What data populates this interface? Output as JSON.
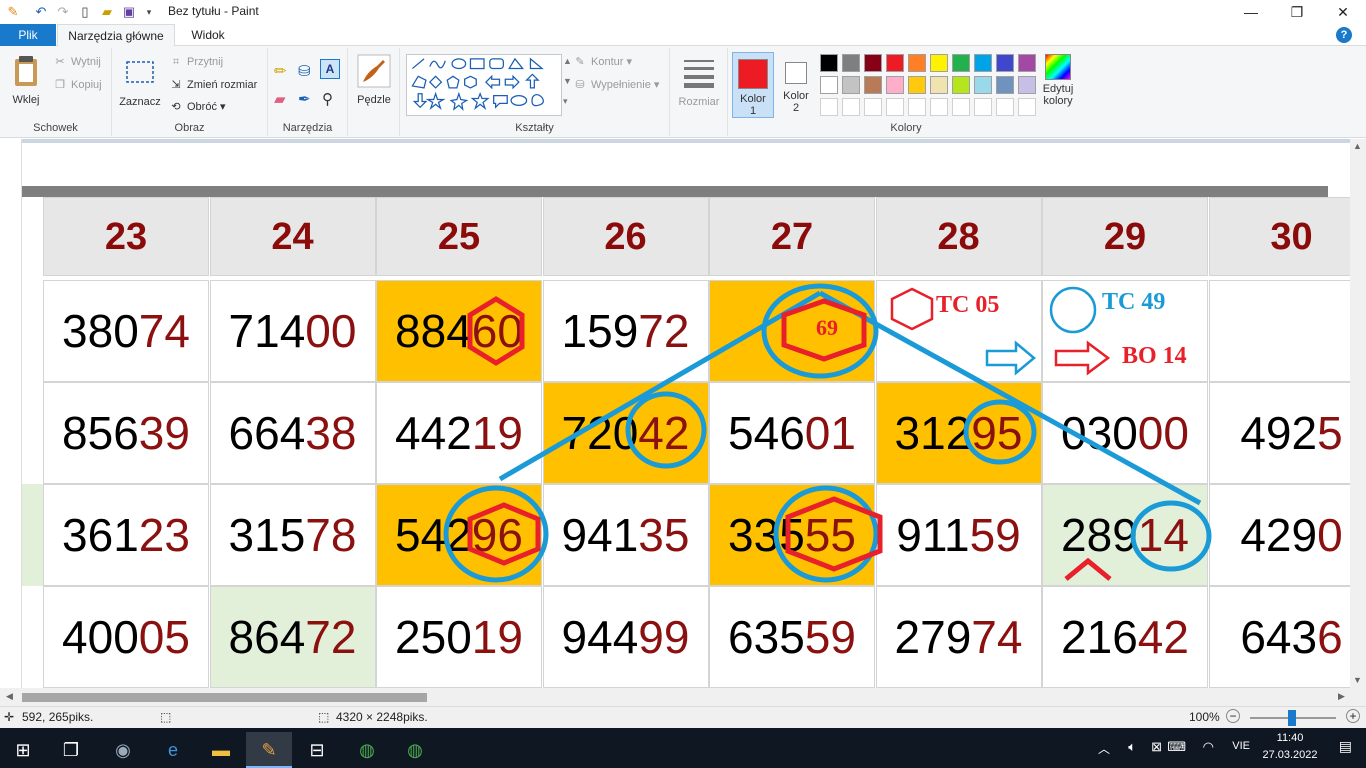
{
  "window": {
    "title": "Bez tytułu - Paint",
    "quick_access": [
      "paint-app-icon",
      "undo-icon",
      "redo-icon",
      "new-file-icon",
      "open-file-icon",
      "save-icon",
      "customize-dropdown-icon"
    ],
    "controls": [
      "minimize-icon",
      "restore-icon",
      "close-icon"
    ]
  },
  "tabs": [
    {
      "label": "Plik",
      "active": false
    },
    {
      "label": "Narzędzia główne",
      "active": true
    },
    {
      "label": "Widok",
      "active": false
    }
  ],
  "help_label": "?",
  "ribbon": {
    "clipboard": {
      "label": "Schowek",
      "paste": "Wklej",
      "cut": "Wytnij",
      "copy": "Kopiuj"
    },
    "image": {
      "label": "Obraz",
      "select": "Zaznacz",
      "crop": "Przytnij",
      "resize": "Zmień rozmiar",
      "rotate": "Obróć"
    },
    "tools": {
      "label": "Narzędzia"
    },
    "brushes": {
      "label": "Pędzle"
    },
    "shapes": {
      "label": "Kształty",
      "outline": "Kontur",
      "fill": "Wypełnienie"
    },
    "size": {
      "label": "Rozmiar"
    },
    "colors": {
      "label": "Kolory",
      "color1": "Kolor 1",
      "color2": "Kolor 2",
      "edit": "Edytuj kolory",
      "color1_value": "#ed1c24",
      "color2_value": "#ffffff",
      "palette_row1": [
        "#000000",
        "#7f7f7f",
        "#880015",
        "#ed1c24",
        "#ff7f27",
        "#fff200",
        "#22b14c",
        "#00a2e8",
        "#3f48cc",
        "#a349a4"
      ],
      "palette_row2": [
        "#ffffff",
        "#c3c3c3",
        "#b97a57",
        "#ffaec9",
        "#ffc90e",
        "#efe4b0",
        "#b5e61d",
        "#99d9ea",
        "#7092be",
        "#c8bfe7"
      ]
    }
  },
  "grid": {
    "headers": [
      "23",
      "24",
      "25",
      "26",
      "27",
      "28",
      "29",
      "30"
    ],
    "rows": [
      [
        {
          "head": "380",
          "tail": "74",
          "bg": "white"
        },
        {
          "head": "714",
          "tail": "00",
          "bg": "white"
        },
        {
          "head": "884",
          "tail": "60",
          "bg": "orange"
        },
        {
          "head": "159",
          "tail": "72",
          "bg": "white"
        },
        {
          "head": "",
          "tail": "",
          "bg": "orange"
        },
        {
          "head": "",
          "tail": "",
          "bg": "white"
        },
        {
          "head": "",
          "tail": "",
          "bg": "white"
        },
        {
          "head": "",
          "tail": "",
          "bg": "white"
        }
      ],
      [
        {
          "head": "856",
          "tail": "39",
          "bg": "white"
        },
        {
          "head": "664",
          "tail": "38",
          "bg": "white"
        },
        {
          "head": "442",
          "tail": "19",
          "bg": "white"
        },
        {
          "head": "720",
          "tail": "42",
          "bg": "orange"
        },
        {
          "head": "546",
          "tail": "01",
          "bg": "white"
        },
        {
          "head": "312",
          "tail": "95",
          "bg": "orange"
        },
        {
          "head": "030",
          "tail": "00",
          "bg": "white"
        },
        {
          "head": "492",
          "tail": "5",
          "bg": "white"
        }
      ],
      [
        {
          "head": "361",
          "tail": "23",
          "bg": "white"
        },
        {
          "head": "315",
          "tail": "78",
          "bg": "white"
        },
        {
          "head": "542",
          "tail": "96",
          "bg": "orange"
        },
        {
          "head": "941",
          "tail": "35",
          "bg": "white"
        },
        {
          "head": "335",
          "tail": "55",
          "bg": "orange"
        },
        {
          "head": "911",
          "tail": "59",
          "bg": "white"
        },
        {
          "head": "289",
          "tail": "14",
          "bg": "lgreen"
        },
        {
          "head": "429",
          "tail": "0",
          "bg": "white"
        }
      ],
      [
        {
          "head": "400",
          "tail": "05",
          "bg": "white"
        },
        {
          "head": "864",
          "tail": "72",
          "bg": "lgreen"
        },
        {
          "head": "250",
          "tail": "19",
          "bg": "white"
        },
        {
          "head": "944",
          "tail": "99",
          "bg": "white"
        },
        {
          "head": "635",
          "tail": "59",
          "bg": "white"
        },
        {
          "head": "279",
          "tail": "74",
          "bg": "white"
        },
        {
          "head": "216",
          "tail": "42",
          "bg": "white"
        },
        {
          "head": "643",
          "tail": "6",
          "bg": "white"
        }
      ]
    ]
  },
  "annotations": {
    "center_value": "69",
    "tc05": "TC 05",
    "tc49": "TC 49",
    "bo14": "BO 14",
    "red": "#e8202a",
    "blue": "#1a9ad6"
  },
  "status": {
    "cursor_pos": "592, 265piks.",
    "image_size": "4320 × 2248piks.",
    "zoom": "100%"
  },
  "taskbar": {
    "apps": [
      "windows-start-icon",
      "task-view-icon",
      "control-panel-icon",
      "edge-icon",
      "file-explorer-icon",
      "paint-icon",
      "store-icon",
      "app-green-icon",
      "app-green-icon-2"
    ],
    "language": "VIE",
    "time": "11:40",
    "date": "27.03.2022"
  }
}
